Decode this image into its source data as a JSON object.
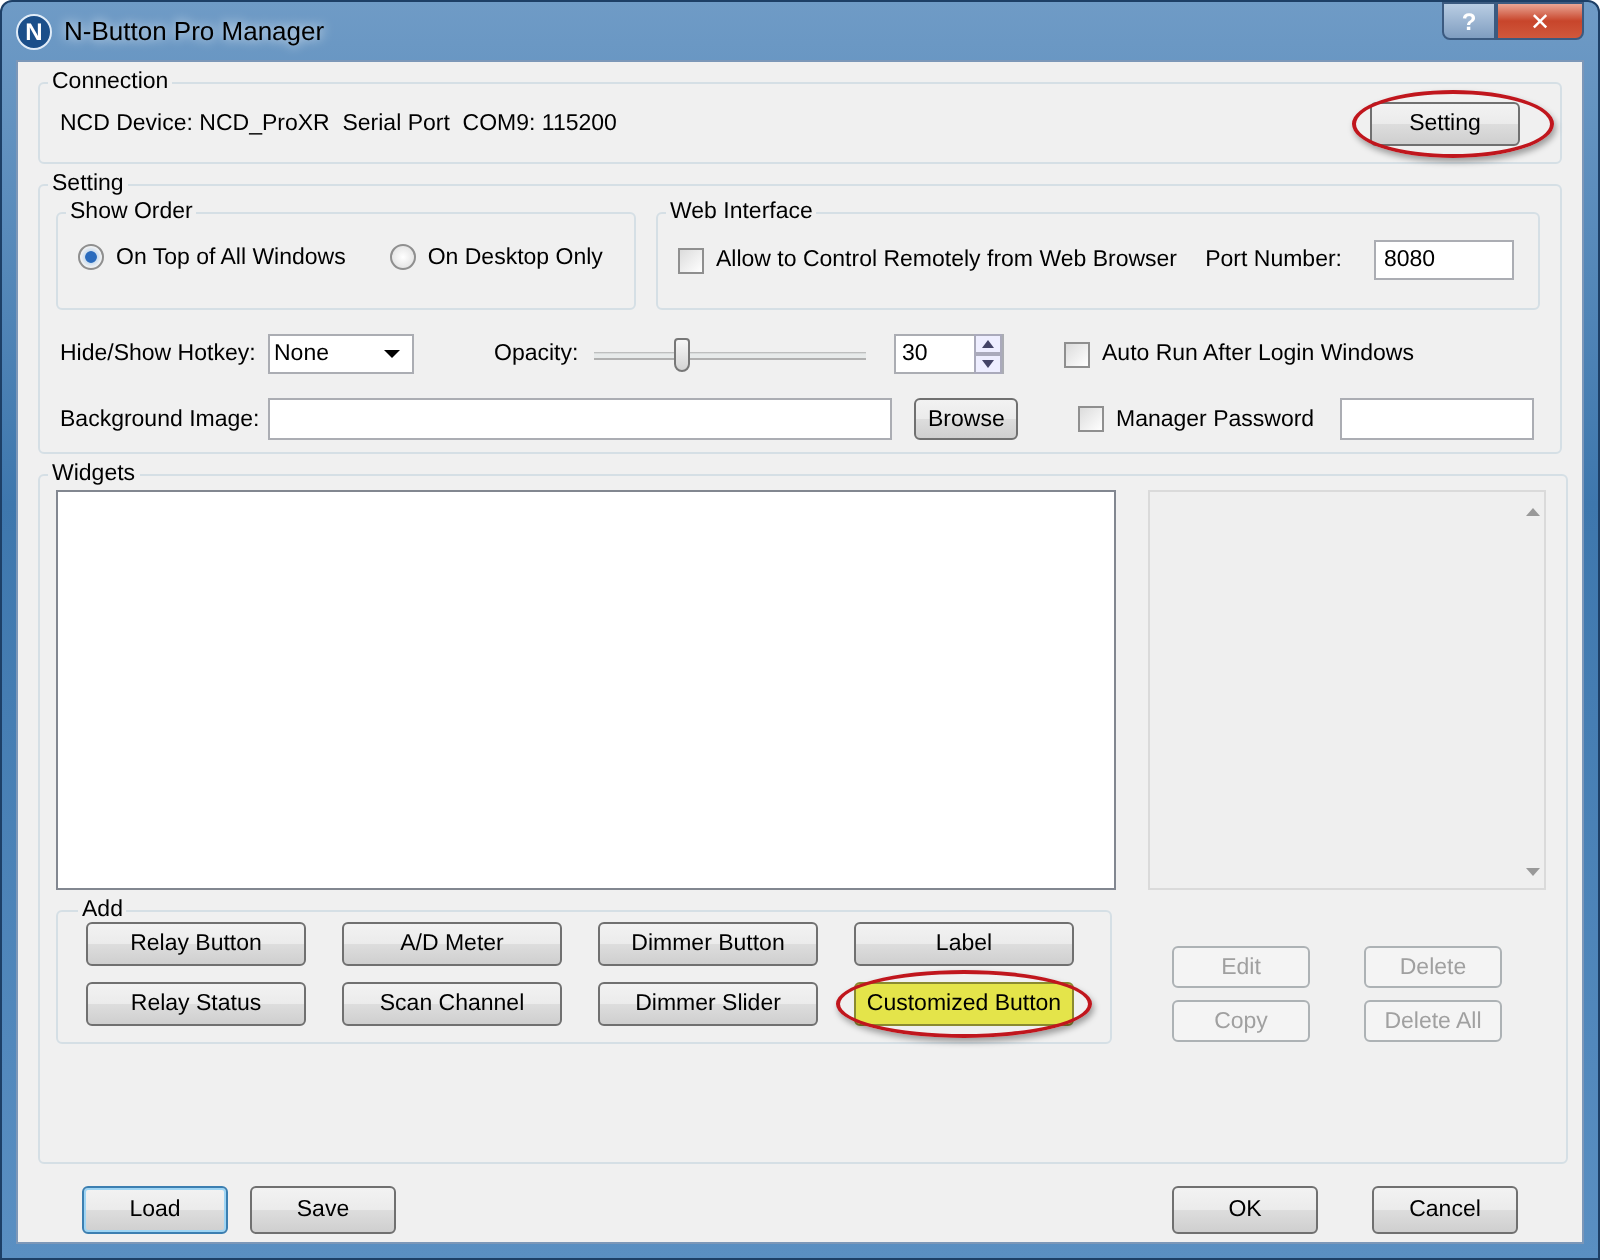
{
  "window": {
    "title": "N-Button Pro Manager",
    "logo": "N",
    "controls": [
      "?",
      "✕"
    ]
  },
  "connection": {
    "title": "Connection",
    "info": "NCD Device: NCD_ProXR  Serial Port  COM9: 115200",
    "button": {
      "label": "Setting",
      "circled": true
    }
  },
  "setting": {
    "title": "Setting",
    "show_order": {
      "title": "Show Order",
      "options": [
        {
          "label": "On Top of All Windows",
          "selected": true
        },
        {
          "label": "On Desktop Only",
          "selected": false
        }
      ]
    },
    "web_interface": {
      "title": "Web Interface",
      "remote": {
        "label": "Allow to Control Remotely from Web Browser",
        "checked": false
      },
      "port_label": "Port Number:",
      "port_value": "8080"
    },
    "hotkey": {
      "label": "Hide/Show Hotkey:",
      "value": "None"
    },
    "opacity": {
      "label": "Opacity:",
      "level": 0.32,
      "value": "30"
    },
    "auto_run": {
      "label": "Auto Run After Login Windows",
      "checked": false
    },
    "background": {
      "label": "Background Image:",
      "button": "Browse"
    },
    "password": {
      "label": "Manager Password",
      "checked": false
    }
  },
  "widgets": {
    "title": "Widgets",
    "add": {
      "title": "Add",
      "buttons": [
        {
          "label": "Relay Button",
          "circled": false,
          "highlighted": false
        },
        {
          "label": "A/D Meter",
          "circled": false,
          "highlighted": false
        },
        {
          "label": "Dimmer Button",
          "circled": false,
          "highlighted": false
        },
        {
          "label": "Label",
          "circled": false,
          "highlighted": false
        },
        {
          "label": "Relay Status",
          "circled": false,
          "highlighted": false
        },
        {
          "label": "Scan Channel",
          "circled": false,
          "highlighted": false
        },
        {
          "label": "Dimmer Slider",
          "circled": false,
          "highlighted": false
        },
        {
          "label": "Customized Button",
          "circled": true,
          "highlighted": true
        }
      ]
    },
    "actions": [
      {
        "label": "Edit",
        "disabled": true
      },
      {
        "label": "Delete",
        "disabled": true
      },
      {
        "label": "Copy",
        "disabled": true
      },
      {
        "label": "Delete All",
        "disabled": true
      }
    ]
  },
  "footer": {
    "left": [
      {
        "label": "Load",
        "selected": true
      },
      {
        "label": "Save",
        "selected": false
      }
    ],
    "right": [
      {
        "label": "OK",
        "selected": false
      },
      {
        "label": "Cancel",
        "selected": false
      }
    ]
  }
}
